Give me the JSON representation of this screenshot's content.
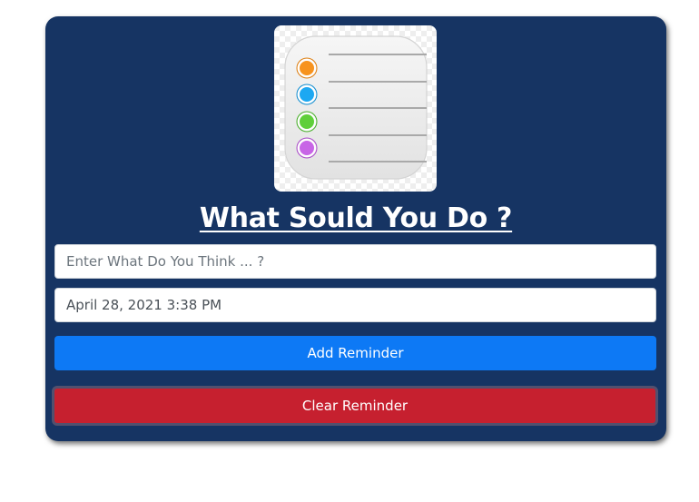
{
  "app": {
    "logo_icon": "reminders-list-icon",
    "title": "What Sould You Do ?"
  },
  "form": {
    "task_placeholder": "Enter What Do You Think ... ?",
    "task_value": "",
    "date_value": "April 28, 2021 3:38 PM"
  },
  "buttons": {
    "add_label": "Add Reminder",
    "clear_label": "Clear Reminder"
  },
  "colors": {
    "card_background": "#163463",
    "add_button": "#0d79f5",
    "clear_button": "#c6202f",
    "dot_orange": "#f7931e",
    "dot_blue": "#1da8f2",
    "dot_green": "#5fcf3a",
    "dot_purple": "#c865e6"
  }
}
